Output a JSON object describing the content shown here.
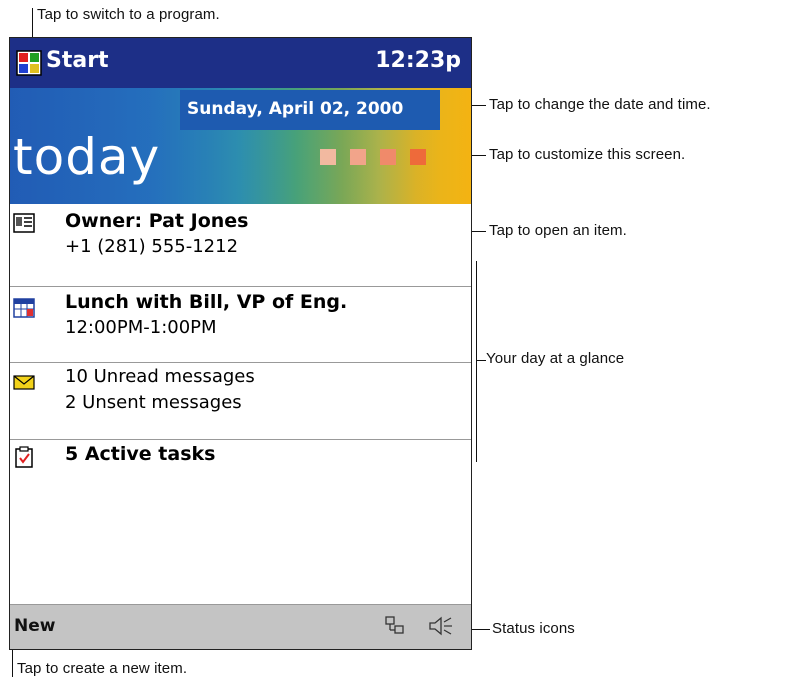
{
  "callouts": {
    "switch_program": "Tap to switch to a program.",
    "change_date": "Tap to change the date and time.",
    "customize": "Tap to customize this screen.",
    "open_item": "Tap to open an item.",
    "day_glance": "Your day at a glance",
    "status_icons": "Status icons",
    "create_item": "Tap to create a new item."
  },
  "titlebar": {
    "start_label": "Start",
    "clock": "12:23p"
  },
  "banner": {
    "date": "Sunday, April 02, 2000",
    "today_label": "today",
    "square_colors": [
      "#f2b9a0",
      "#f2a48a",
      "#f08a6a",
      "#ee6a3a"
    ]
  },
  "items": [
    {
      "icon": "owner-card-icon",
      "title": "Owner: Pat Jones",
      "subtitle": "+1 (281) 555-1212"
    },
    {
      "icon": "calendar-icon",
      "title": "Lunch with Bill, VP of Eng.",
      "subtitle": "12:00PM-1:00PM"
    },
    {
      "icon": "envelope-icon",
      "title": "10 Unread messages",
      "subtitle": "2 Unsent messages"
    },
    {
      "icon": "task-clipboard-icon",
      "title": "5 Active tasks",
      "subtitle": ""
    }
  ],
  "bottombar": {
    "new_label": "New",
    "status_icons": [
      "network-icon",
      "speaker-icon"
    ]
  },
  "colors": {
    "titlebar": "#1d2f87",
    "bottombar": "#c4c4c4",
    "date_band": "#1e5bb0"
  }
}
